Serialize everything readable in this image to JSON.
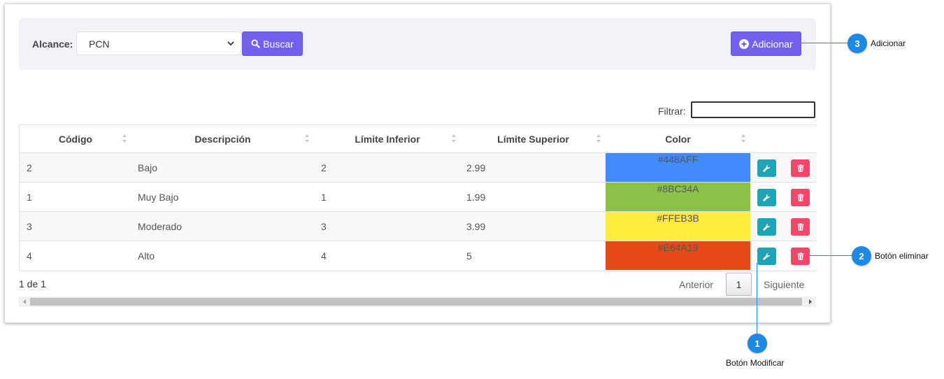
{
  "toolbar": {
    "scope_label": "Alcance:",
    "scope_value": "PCN",
    "search_label": "Buscar",
    "add_label": "Adicionar"
  },
  "filter": {
    "label": "Filtrar:",
    "value": ""
  },
  "table": {
    "headers": [
      "Código",
      "Descripción",
      "Límite Inferior",
      "Límite Superior",
      "Color"
    ],
    "rows": [
      {
        "code": "2",
        "description": "Bajo",
        "lower": "2",
        "upper": "2.99",
        "color_label": "#448AFF",
        "color": "#448AFF"
      },
      {
        "code": "1",
        "description": "Muy Bajo",
        "lower": "1",
        "upper": "1.99",
        "color_label": "#8BC34A",
        "color": "#8BC34A"
      },
      {
        "code": "3",
        "description": "Moderado",
        "lower": "3",
        "upper": "3.99",
        "color_label": "#FFEB3B",
        "color": "#FFEB3B"
      },
      {
        "code": "4",
        "description": "Alto",
        "lower": "4",
        "upper": "5",
        "color_label": "#E64A19",
        "color": "#E64A19"
      }
    ]
  },
  "pagination": {
    "info": "1 de 1",
    "prev": "Anterior",
    "page": "1",
    "next": "Siguiente"
  },
  "callouts": [
    {
      "number": "1",
      "label": "Botón Modificar"
    },
    {
      "number": "2",
      "label": "Botón eliminar"
    },
    {
      "number": "3",
      "label": "Adicionar"
    }
  ],
  "colors": {
    "primary_button": "#7460EE",
    "edit_button": "#1FA4B7",
    "delete_button": "#F0476A",
    "callout": "#1E88E5"
  },
  "icons": [
    "chevron-down-icon",
    "search-icon",
    "plus-circle-icon",
    "sort-icon",
    "wrench-icon",
    "trash-icon"
  ]
}
